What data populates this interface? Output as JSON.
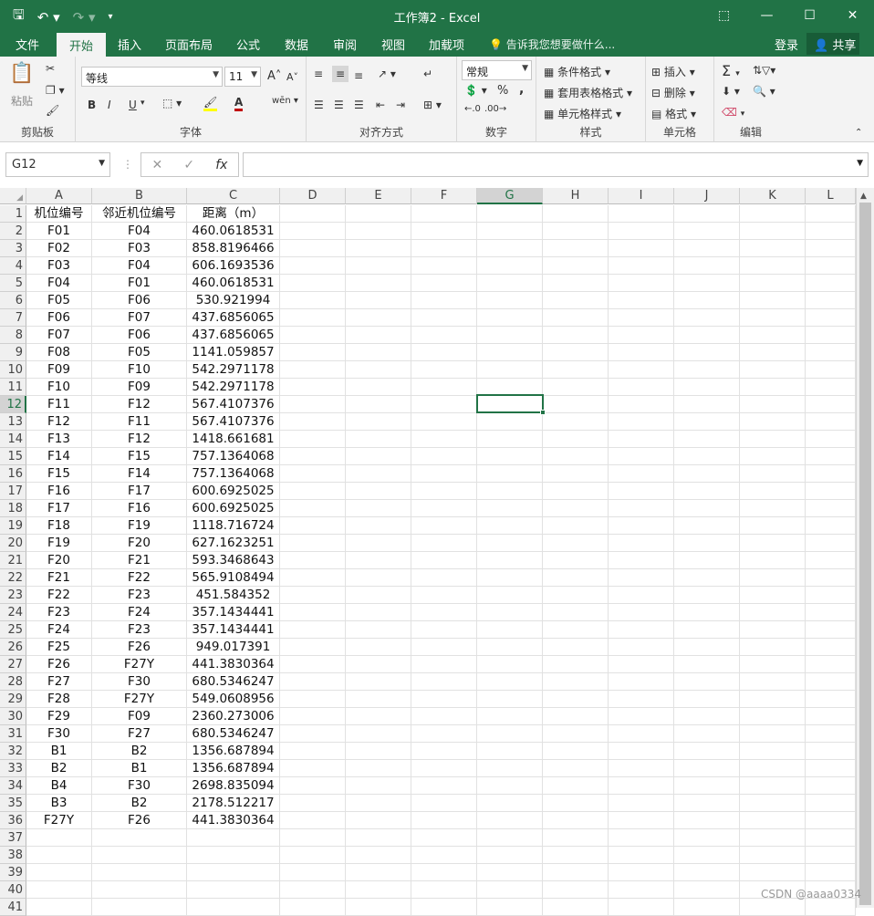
{
  "window": {
    "title": "工作簿2 - Excel",
    "minimize_icon": "minimize-icon",
    "maximize_icon": "maximize-icon",
    "close_icon": "close-icon"
  },
  "menu": {
    "tabs": [
      "文件",
      "开始",
      "插入",
      "页面布局",
      "公式",
      "数据",
      "审阅",
      "视图",
      "加载项"
    ],
    "active_tab": "开始",
    "tell_me": "告诉我您想要做什么...",
    "login": "登录",
    "share": "共享"
  },
  "ribbon": {
    "clipboard": {
      "paste": "粘贴",
      "label": "剪贴板"
    },
    "font": {
      "family": "等线",
      "size": "11",
      "label": "字体",
      "bold": "B",
      "italic": "I",
      "underline": "U"
    },
    "alignment": {
      "label": "对齐方式"
    },
    "number": {
      "format": "常规",
      "percent": "%",
      "comma": ",",
      "label": "数字"
    },
    "styles": {
      "conditional": "条件格式",
      "table": "套用表格格式",
      "cell": "单元格样式",
      "label": "样式"
    },
    "cells": {
      "insert": "插入",
      "delete": "删除",
      "format": "格式",
      "label": "单元格"
    },
    "editing": {
      "label": "编辑"
    }
  },
  "formula_bar": {
    "name_box": "G12",
    "fx": "fx",
    "value": ""
  },
  "sheet": {
    "columns": [
      "A",
      "B",
      "C",
      "D",
      "E",
      "F",
      "G",
      "H",
      "I",
      "J",
      "K",
      "L"
    ],
    "selected_column": "G",
    "selected_row": 12,
    "selected_cell": "G12",
    "rows": [
      [
        "机位编号",
        "邻近机位编号",
        "距离（m）"
      ],
      [
        "F01",
        "F04",
        "460.0618531"
      ],
      [
        "F02",
        "F03",
        "858.8196466"
      ],
      [
        "F03",
        "F04",
        "606.1693536"
      ],
      [
        "F04",
        "F01",
        "460.0618531"
      ],
      [
        "F05",
        "F06",
        "530.921994"
      ],
      [
        "F06",
        "F07",
        "437.6856065"
      ],
      [
        "F07",
        "F06",
        "437.6856065"
      ],
      [
        "F08",
        "F05",
        "1141.059857"
      ],
      [
        "F09",
        "F10",
        "542.2971178"
      ],
      [
        "F10",
        "F09",
        "542.2971178"
      ],
      [
        "F11",
        "F12",
        "567.4107376"
      ],
      [
        "F12",
        "F11",
        "567.4107376"
      ],
      [
        "F13",
        "F12",
        "1418.661681"
      ],
      [
        "F14",
        "F15",
        "757.1364068"
      ],
      [
        "F15",
        "F14",
        "757.1364068"
      ],
      [
        "F16",
        "F17",
        "600.6925025"
      ],
      [
        "F17",
        "F16",
        "600.6925025"
      ],
      [
        "F18",
        "F19",
        "1118.716724"
      ],
      [
        "F19",
        "F20",
        "627.1623251"
      ],
      [
        "F20",
        "F21",
        "593.3468643"
      ],
      [
        "F21",
        "F22",
        "565.9108494"
      ],
      [
        "F22",
        "F23",
        "451.584352"
      ],
      [
        "F23",
        "F24",
        "357.1434441"
      ],
      [
        "F24",
        "F23",
        "357.1434441"
      ],
      [
        "F25",
        "F26",
        "949.017391"
      ],
      [
        "F26",
        "F27Y",
        "441.3830364"
      ],
      [
        "F27",
        "F30",
        "680.5346247"
      ],
      [
        "F28",
        "F27Y",
        "549.0608956"
      ],
      [
        "F29",
        "F09",
        "2360.273006"
      ],
      [
        "F30",
        "F27",
        "680.5346247"
      ],
      [
        "B1",
        "B2",
        "1356.687894"
      ],
      [
        "B2",
        "B1",
        "1356.687894"
      ],
      [
        "B4",
        "F30",
        "2698.835094"
      ],
      [
        "B3",
        "B2",
        "2178.512217"
      ],
      [
        "F27Y",
        "F26",
        "441.3830364"
      ],
      [
        "",
        "",
        ""
      ],
      [
        "",
        "",
        ""
      ],
      [
        "",
        "",
        ""
      ],
      [
        "",
        "",
        ""
      ],
      [
        "",
        "",
        ""
      ]
    ]
  },
  "watermark": "CSDN @aaaa0334"
}
